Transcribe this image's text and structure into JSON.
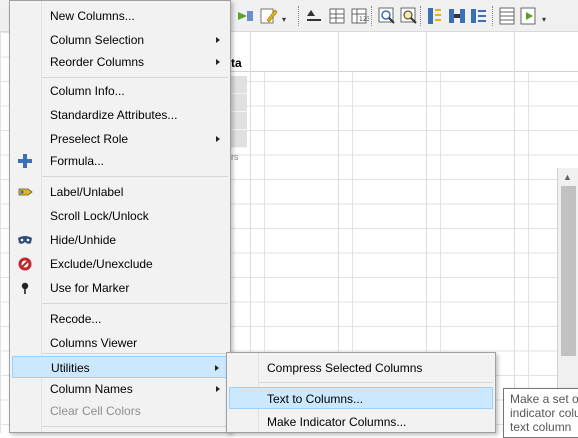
{
  "background": {
    "column_header_fragment": "ta",
    "column_subtext_fragment": "rs",
    "tooltip_lines": [
      "Make a set of",
      "indicator colu",
      "text column"
    ]
  },
  "menu": {
    "items": [
      {
        "label": "New Columns...",
        "submenu": false
      },
      {
        "label": "Column Selection",
        "submenu": true
      },
      {
        "label": "Reorder Columns",
        "submenu": true
      },
      {
        "label": "Column Info...",
        "submenu": false
      },
      {
        "label": "Standardize Attributes...",
        "submenu": false
      },
      {
        "label": "Preselect Role",
        "submenu": true
      },
      {
        "label": "Formula...",
        "submenu": false,
        "icon": "plus-icon"
      },
      {
        "label": "Label/Unlabel",
        "submenu": false,
        "icon": "label-tag-icon"
      },
      {
        "label": "Scroll Lock/Unlock",
        "submenu": false
      },
      {
        "label": "Hide/Unhide",
        "submenu": false,
        "icon": "mask-icon"
      },
      {
        "label": "Exclude/Unexclude",
        "submenu": false,
        "icon": "exclude-icon"
      },
      {
        "label": "Use for Marker",
        "submenu": false,
        "icon": "marker-pin-icon"
      },
      {
        "label": "Recode...",
        "submenu": false
      },
      {
        "label": "Columns Viewer",
        "submenu": false
      },
      {
        "label": "Utilities",
        "submenu": true,
        "highlighted": true
      },
      {
        "label": "Column Names",
        "submenu": true
      },
      {
        "label": "Clear Cell Colors",
        "submenu": false,
        "disabled": true
      }
    ]
  },
  "submenu": {
    "items": [
      {
        "label": "Compress Selected Columns"
      },
      {
        "label": "Text to Columns...",
        "highlighted": true
      },
      {
        "label": "Make Indicator Columns..."
      }
    ]
  },
  "colors": {
    "highlight_bg": "#cce8ff",
    "highlight_border": "#99d1ff",
    "menu_bg": "#f2f2f2",
    "icon_blue": "#3b6fb6",
    "icon_red": "#c0262b"
  }
}
